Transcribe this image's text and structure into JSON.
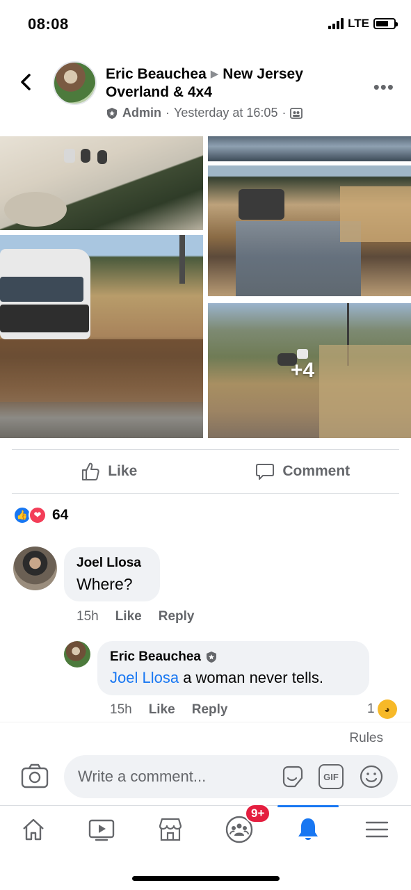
{
  "status_bar": {
    "time": "08:08",
    "network": "LTE"
  },
  "post": {
    "author": "Eric Beauchea",
    "group": "New Jersey Overland & 4x4",
    "role": "Admin",
    "timestamp": "Yesterday at 16:05",
    "more_photos": "+4"
  },
  "actions": {
    "like": "Like",
    "comment": "Comment"
  },
  "reactions": {
    "count": "64"
  },
  "comments": [
    {
      "author": "Joel Llosa",
      "text": "Where?",
      "age": "15h",
      "like": "Like",
      "reply": "Reply"
    },
    {
      "author": "Eric Beauchea",
      "mention": "Joel Llosa",
      "text": " a woman never tells.",
      "age": "15h",
      "like": "Like",
      "reply": "Reply",
      "reaction_count": "1"
    }
  ],
  "composer": {
    "rules": "Rules",
    "placeholder": "Write a comment...",
    "gif": "GIF"
  },
  "tabbar": {
    "notifications_badge": "9+"
  },
  "colors": {
    "accent": "#1877f2",
    "secondary_text": "#65676b",
    "bubble": "#f0f2f5",
    "badge": "#e41e3f"
  }
}
